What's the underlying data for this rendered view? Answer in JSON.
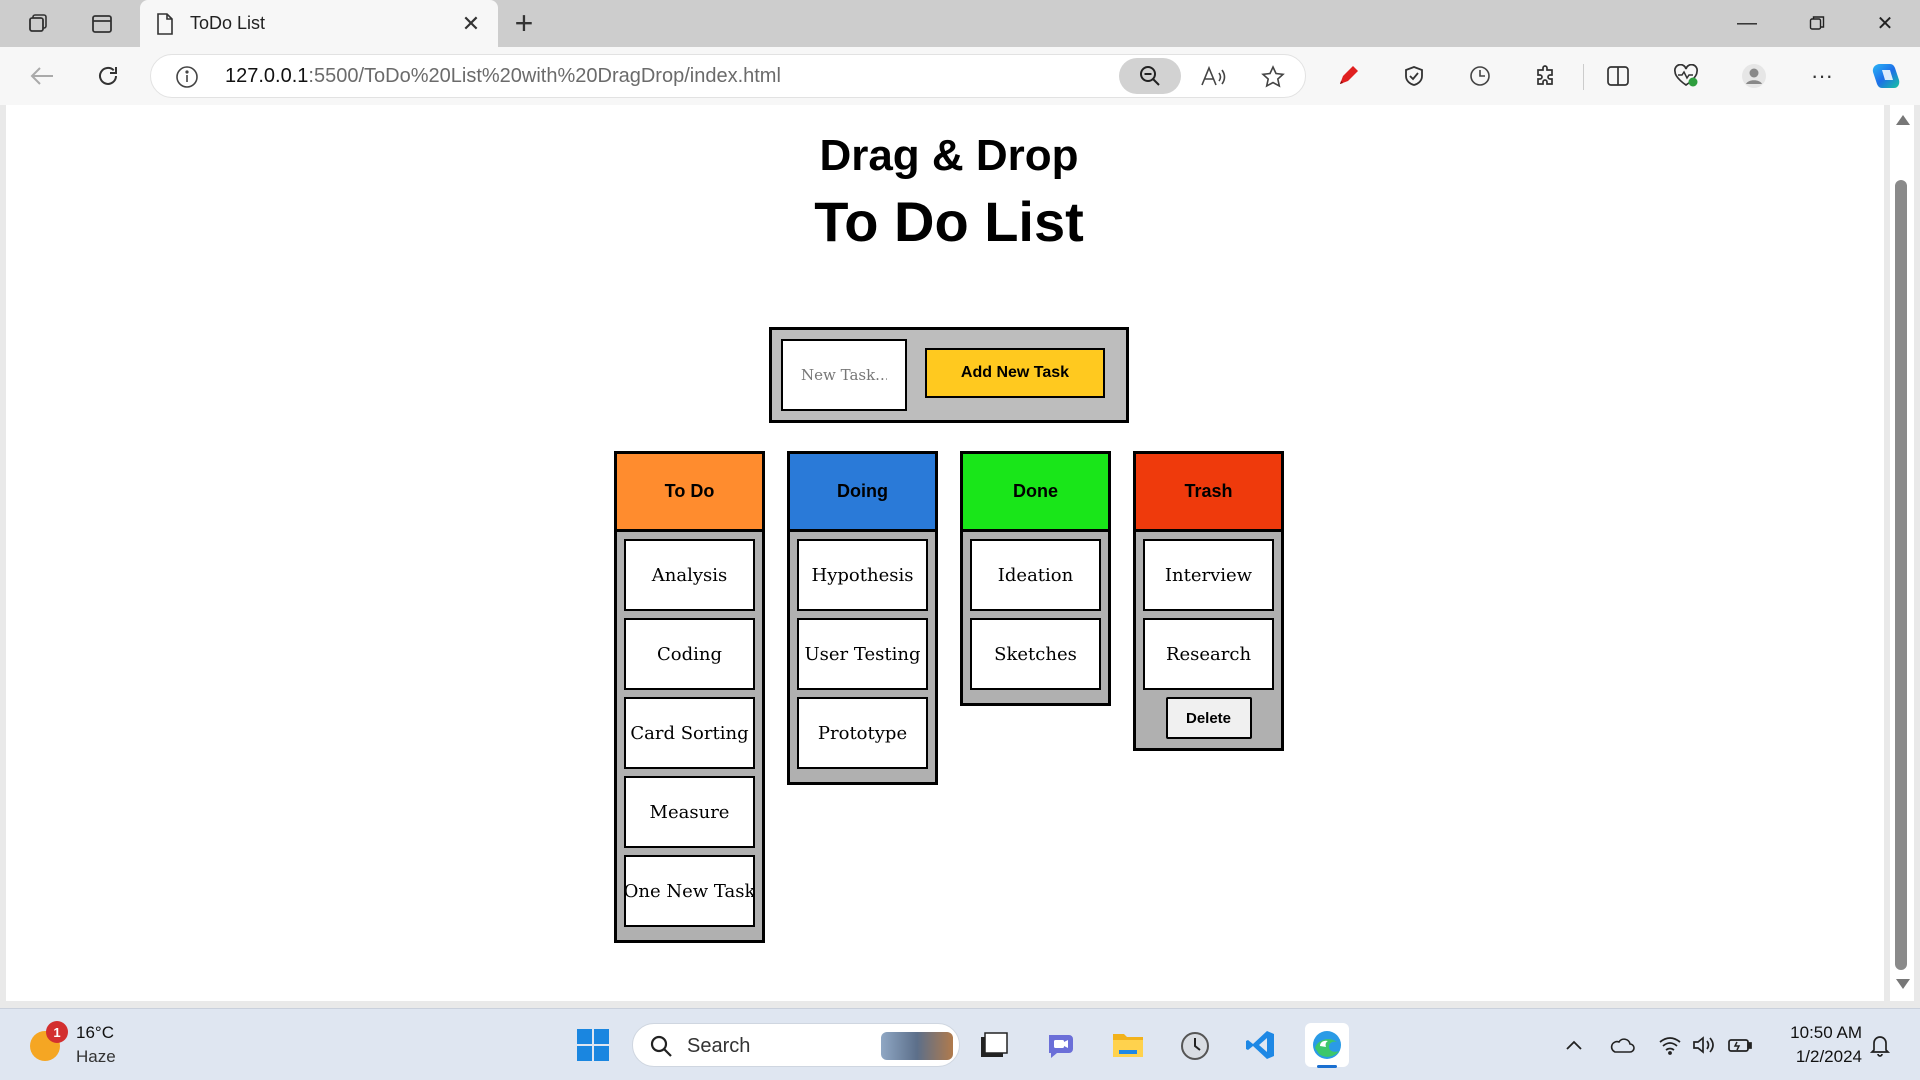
{
  "browser": {
    "tab_title": "ToDo List",
    "url_host": "127.0.0.1",
    "url_rest": ":5500/ToDo%20List%20with%20DragDrop/index.html"
  },
  "page": {
    "subtitle": "Drag & Drop",
    "title": "To Do List",
    "input_placeholder": "New Task...",
    "input_value": "",
    "add_button": "Add New Task",
    "delete_button": "Delete",
    "columns": [
      {
        "name": "To Do",
        "color": "#ff8c2e",
        "tasks": [
          "Analysis",
          "Coding",
          "Card Sorting",
          "Measure",
          "One New Task"
        ]
      },
      {
        "name": "Doing",
        "color": "#2a7ad8",
        "tasks": [
          "Hypothesis",
          "User Testing",
          "Prototype"
        ]
      },
      {
        "name": "Done",
        "color": "#19e619",
        "tasks": [
          "Ideation",
          "Sketches"
        ]
      },
      {
        "name": "Trash",
        "color": "#ef3a0c",
        "tasks": [
          "Interview",
          "Research"
        ]
      }
    ]
  },
  "taskbar": {
    "weather_badge": "1",
    "temperature": "16°C",
    "condition": "Haze",
    "search_label": "Search",
    "time": "10:50 AM",
    "date": "1/2/2024"
  },
  "colors": {
    "accent_button": "#ffc91f",
    "column_body": "#b0b0b0",
    "add_box": "#bdbdbd"
  }
}
